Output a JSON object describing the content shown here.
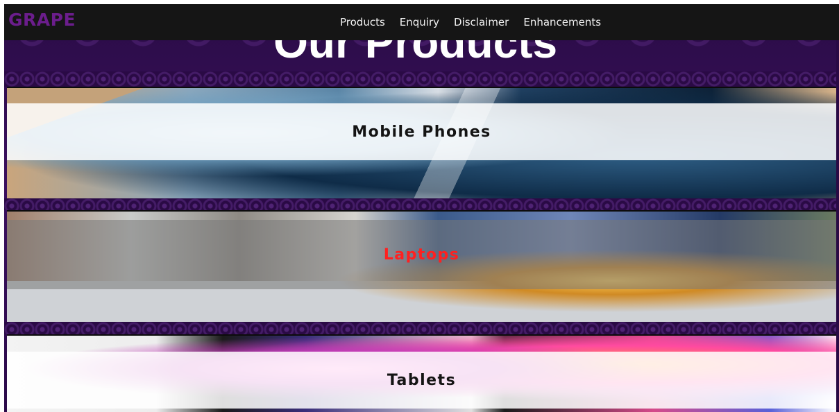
{
  "navbar": {
    "logo": "GRAPE",
    "links": [
      "Products",
      "Enquiry",
      "Disclaimer",
      "Enhancements"
    ]
  },
  "page": {
    "title": "Our Products"
  },
  "products": [
    {
      "label": "Mobile Phones"
    },
    {
      "label": "Laptops"
    },
    {
      "label": "Tablets"
    }
  ],
  "colors": {
    "logo": "#6b1d8c",
    "navbar_bg": "#151515",
    "title_underline": "#e01020",
    "hover_label": "#ff2020",
    "background": "#3a0f5e"
  }
}
